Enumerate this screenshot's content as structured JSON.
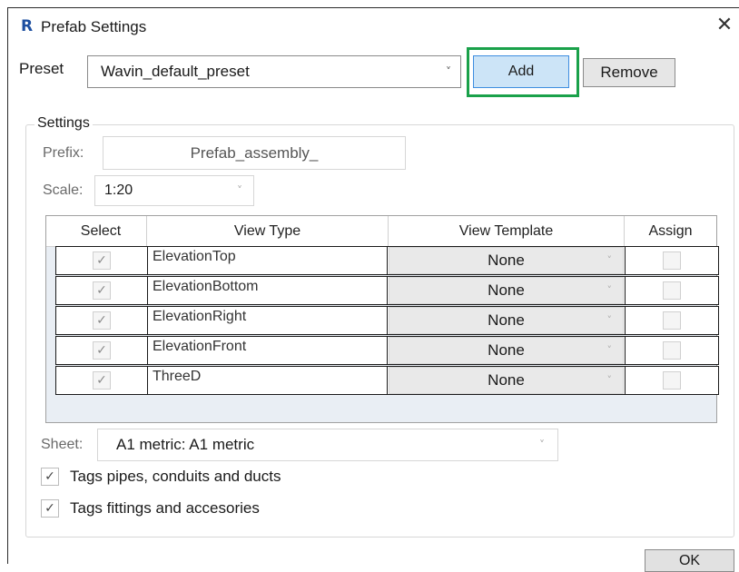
{
  "window": {
    "title": "Prefab Settings",
    "logo_letter": "R"
  },
  "preset": {
    "label": "Preset",
    "selected": "Wavin_default_preset",
    "add_label": "Add",
    "remove_label": "Remove"
  },
  "settings": {
    "group_title": "Settings",
    "prefix_label": "Prefix:",
    "prefix_value": "Prefab_assembly_",
    "scale_label": "Scale:",
    "scale_value": "1:20"
  },
  "grid": {
    "columns": [
      "Select",
      "View Type",
      "View Template",
      "Assign"
    ],
    "rows": [
      {
        "view_type": "ElevationTop",
        "template": "None"
      },
      {
        "view_type": "ElevationBottom",
        "template": "None"
      },
      {
        "view_type": "ElevationRight",
        "template": "None"
      },
      {
        "view_type": "ElevationFront",
        "template": "None"
      },
      {
        "view_type": "ThreeD",
        "template": "None"
      }
    ]
  },
  "sheet": {
    "label": "Sheet:",
    "value": "A1 metric: A1 metric"
  },
  "options": {
    "tags_pipes": "Tags pipes, conduits and ducts",
    "tags_fittings": "Tags fittings and accesories"
  },
  "footer": {
    "ok_label": "OK"
  },
  "icons": {
    "check": "✓",
    "chevron": "˅",
    "close": "✕"
  },
  "colors": {
    "add_button_bg": "#cce4f7",
    "highlight": "#1aa14a",
    "logo": "#1d4fa0"
  }
}
